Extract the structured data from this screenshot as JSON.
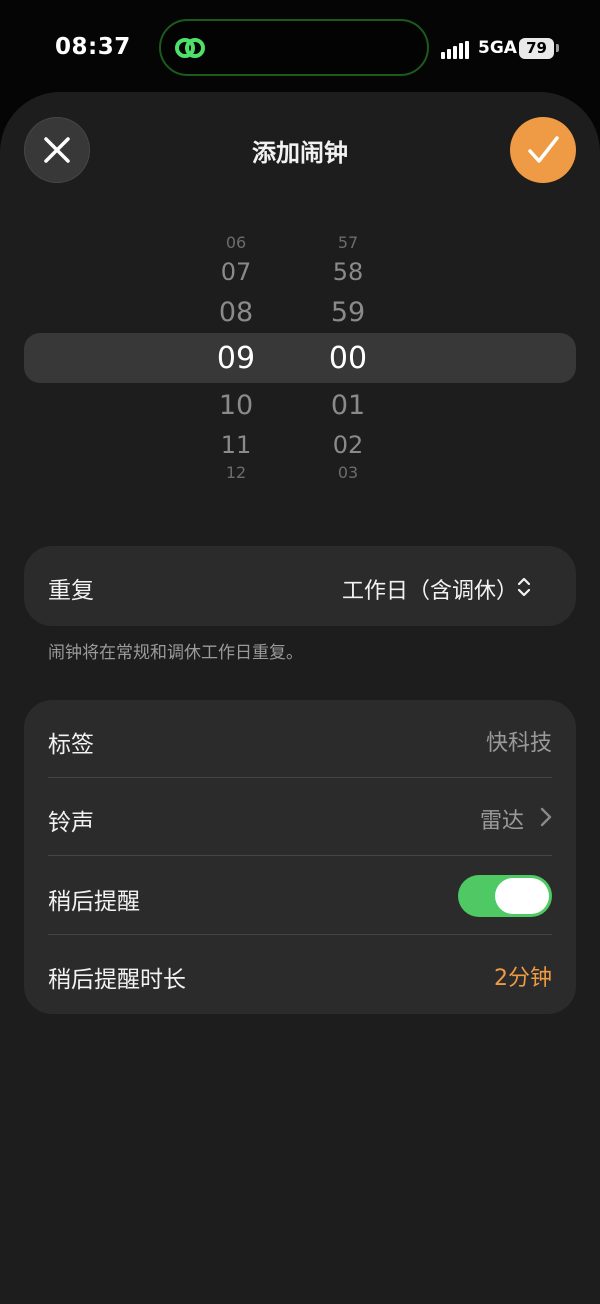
{
  "status_bar": {
    "time": "08:37",
    "network": "5GA",
    "battery": "79"
  },
  "header": {
    "title": "添加闹钟",
    "close_icon": "close-icon",
    "confirm_icon": "checkmark-icon"
  },
  "picker": {
    "hours": [
      "06",
      "07",
      "08",
      "09",
      "10",
      "11",
      "12"
    ],
    "minutes": [
      "57",
      "58",
      "59",
      "00",
      "01",
      "02",
      "03"
    ],
    "selected_hour": "09",
    "selected_minute": "00"
  },
  "repeat": {
    "label": "重复",
    "value": "工作日（含调休）",
    "note": "闹钟将在常规和调休工作日重复。"
  },
  "settings": {
    "tag": {
      "label": "标签",
      "value": "快科技"
    },
    "sound": {
      "label": "铃声",
      "value": "雷达"
    },
    "snooze": {
      "label": "稍后提醒",
      "enabled": true
    },
    "snooze_duration": {
      "label": "稍后提醒时长",
      "value": "2分钟"
    }
  },
  "colors": {
    "accent": "#ef9a45",
    "toggle_on": "#4ec964"
  }
}
